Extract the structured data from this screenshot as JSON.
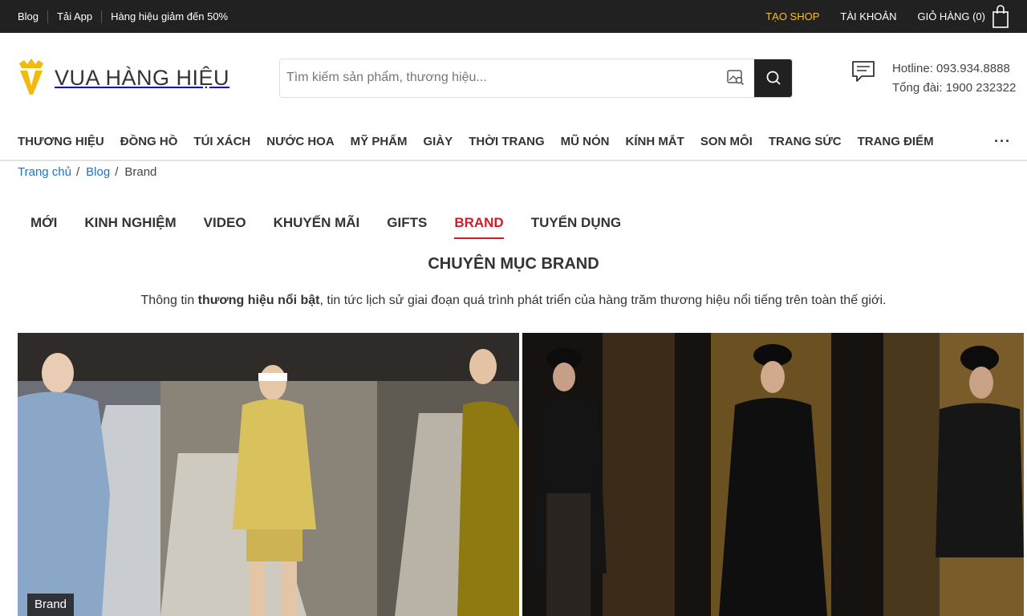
{
  "topbar": {
    "links": [
      "Blog",
      "Tải App",
      "Hàng hiệu giảm đến 50%"
    ],
    "open_shop": "TẠO SHOP",
    "account": "TÀI KHOẢN",
    "cart": "GIỎ HÀNG (0)",
    "accent_color": "#f3c02e"
  },
  "header": {
    "logo_text": "VUA HÀNG HIỆU",
    "search_placeholder": "Tìm kiếm sản phẩm, thương hiệu...",
    "hotline": "Hotline: 093.934.8888",
    "switchboard": "Tổng đài: 1900 232322"
  },
  "nav": {
    "items": [
      "THƯƠNG HIỆU",
      "ĐỒNG HỒ",
      "TÚI XÁCH",
      "NƯỚC HOA",
      "MỸ PHẨM",
      "GIÀY",
      "THỜI TRANG",
      "MŨ NÓN",
      "KÍNH MẮT",
      "SON MÔI",
      "TRANG SỨC",
      "TRANG ĐIỂM"
    ],
    "more": "···"
  },
  "breadcrumb": {
    "home": "Trang chủ",
    "blog": "Blog",
    "current": "Brand"
  },
  "tabs": [
    "MỚI",
    "KINH NGHIỆM",
    "VIDEO",
    "KHUYẾN MÃI",
    "GIFTS",
    "BRAND",
    "TUYỂN DỤNG"
  ],
  "active_tab": "BRAND",
  "category": {
    "title": "CHUYÊN MỤC BRAND",
    "desc_pre": "Thông tin ",
    "desc_bold": "thương hiệu nổi bật",
    "desc_post": ", tin tức lịch sử giai đoạn quá trình phát triển của hàng trăm thương hiệu nổi tiếng trên toàn thế giới."
  },
  "articles": [
    {
      "tag": "Brand"
    }
  ],
  "colors": {
    "active_tab": "#c9202a",
    "link": "#1a73c9",
    "topbar_bg": "#212121"
  }
}
